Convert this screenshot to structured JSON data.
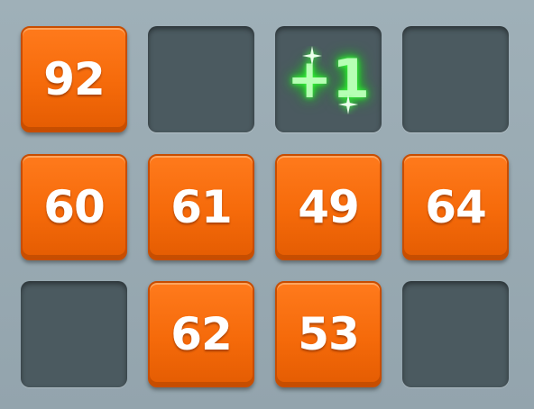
{
  "board": {
    "rows": [
      [
        {
          "type": "tile",
          "value": "92"
        },
        {
          "type": "empty"
        },
        {
          "type": "bonus",
          "label": "+1"
        },
        {
          "type": "empty"
        }
      ],
      [
        {
          "type": "tile",
          "value": "60"
        },
        {
          "type": "tile",
          "value": "61"
        },
        {
          "type": "tile",
          "value": "49"
        },
        {
          "type": "tile",
          "value": "64"
        }
      ],
      [
        {
          "type": "empty"
        },
        {
          "type": "tile",
          "value": "62"
        },
        {
          "type": "tile",
          "value": "53"
        },
        {
          "type": "empty"
        }
      ]
    ]
  },
  "colors": {
    "tile": "#f56a0a",
    "empty_slot": "#4b5a60",
    "board": "#95a6ae",
    "bonus_glow": "#38ff3a"
  },
  "icons": {
    "bonus_sparkle": "sparkle-icon"
  }
}
